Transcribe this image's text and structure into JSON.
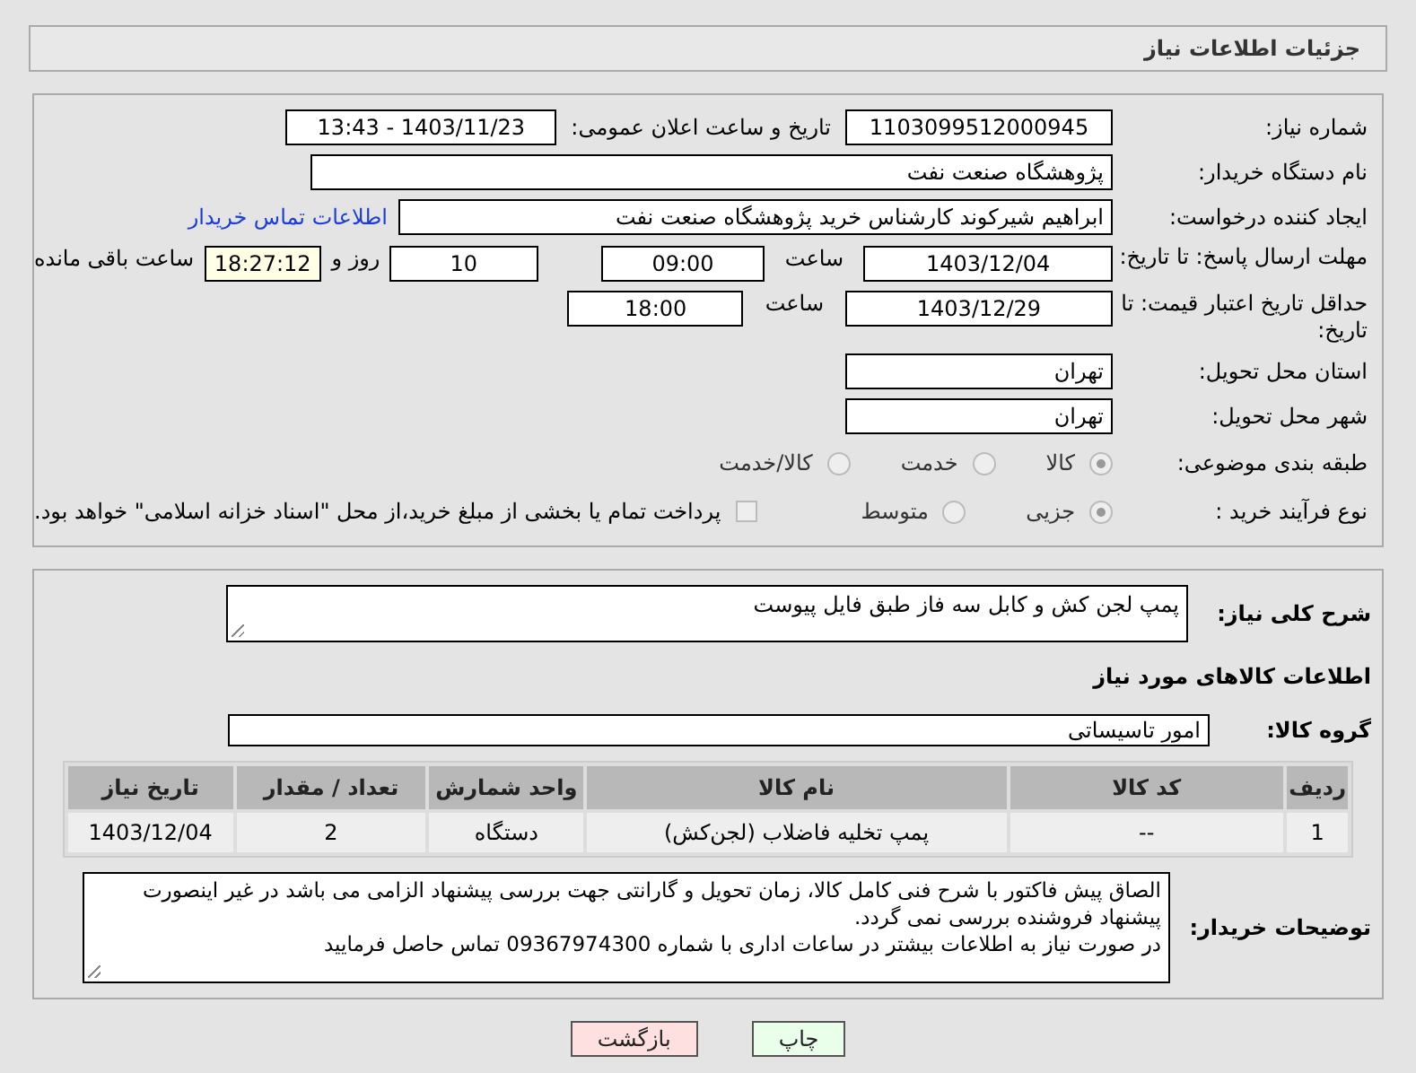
{
  "title": "جزئیات اطلاعات نیاز",
  "need_number": {
    "label": "شماره نیاز:",
    "value": "1103099512000945"
  },
  "announce": {
    "label": "تاریخ و ساعت اعلان عمومی:",
    "value": "1403/11/23 - 13:43"
  },
  "buyer_org": {
    "label": "نام دستگاه خریدار:",
    "value": "پژوهشگاه صنعت نفت"
  },
  "requester": {
    "label": "ایجاد کننده درخواست:",
    "value": "ابراهیم شیرکوند کارشناس خرید پژوهشگاه صنعت نفت",
    "link": "اطلاعات تماس خریدار"
  },
  "deadline": {
    "label": "مهلت ارسال پاسخ: تا تاریخ:",
    "date": "1403/12/04",
    "time_label": "ساعت",
    "time": "09:00",
    "days": "10",
    "days_label": "روز و",
    "remaining": "18:27:12",
    "remaining_label": "ساعت باقی مانده"
  },
  "validity": {
    "label": "حداقل تاریخ اعتبار قیمت: تا تاریخ:",
    "date": "1403/12/29",
    "time_label": "ساعت",
    "time": "18:00"
  },
  "province": {
    "label": "استان محل تحویل:",
    "value": "تهران"
  },
  "city": {
    "label": "شهر محل تحویل:",
    "value": "تهران"
  },
  "category": {
    "label": "طبقه بندی موضوعی:",
    "options": [
      {
        "label": "کالا",
        "selected": true
      },
      {
        "label": "خدمت",
        "selected": false
      },
      {
        "label": "کالا/خدمت",
        "selected": false
      }
    ]
  },
  "purchase_process": {
    "label": "نوع فرآیند خرید :",
    "options": [
      {
        "label": "جزیی",
        "selected": true
      },
      {
        "label": "متوسط",
        "selected": false
      }
    ],
    "payment": {
      "label": "پرداخت تمام یا بخشی از مبلغ خرید،از محل \"اسناد خزانه اسلامی\" خواهد بود.",
      "checked": false
    }
  },
  "description": {
    "label": "شرح کلی نیاز:",
    "value": "پمپ لجن کش و کابل سه فاز طبق فایل پیوست"
  },
  "items_title": "اطلاعات کالاهای مورد نیاز",
  "goods_group": {
    "label": "گروه کالا:",
    "value": "امور تاسیساتی"
  },
  "table": {
    "columns": [
      "ردیف",
      "کد کالا",
      "نام کالا",
      "واحد شمارش",
      "تعداد / مقدار",
      "تاریخ نیاز"
    ],
    "rows": [
      [
        "1",
        "--",
        "پمپ تخلیه فاضلاب (لجن‌کش)",
        "دستگاه",
        "2",
        "1403/12/04"
      ]
    ]
  },
  "buyer_notes": {
    "label": "توضیحات خریدار:",
    "lines": [
      "الصاق پیش فاکتور با شرح فنی کامل کالا، زمان تحویل و گارانتی جهت بررسی پیشنهاد الزامی می باشد در غیر اینصورت پیشنهاد فروشنده بررسی نمی گردد.",
      "در صورت نیاز به اطلاعات بیشتر در ساعات اداری با شماره 09367974300 تماس حاصل فرمایید"
    ]
  },
  "buttons": [
    {
      "label": "چاپ",
      "kind": "print"
    },
    {
      "label": "بازگشت",
      "kind": "back"
    }
  ]
}
